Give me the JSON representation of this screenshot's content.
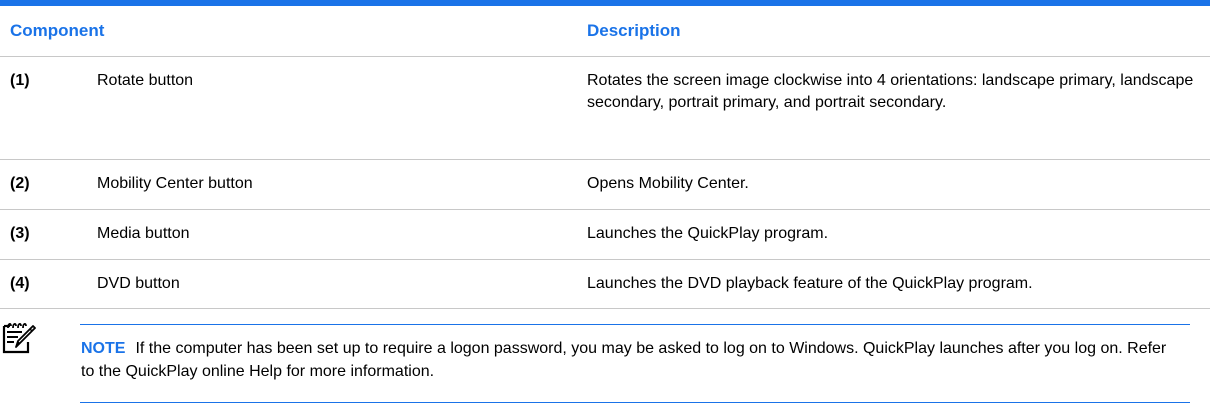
{
  "table": {
    "headers": {
      "component": "Component",
      "description": "Description"
    },
    "rows": [
      {
        "number": "(1)",
        "name": "Rotate button",
        "description": "Rotates the screen image clockwise into 4 orientations: landscape primary, landscape secondary, portrait primary, and portrait secondary."
      },
      {
        "number": "(2)",
        "name": "Mobility Center button",
        "description": "Opens Mobility Center."
      },
      {
        "number": "(3)",
        "name": "Media button",
        "description": "Launches the QuickPlay program."
      },
      {
        "number": "(4)",
        "name": "DVD button",
        "description": "Launches the DVD playback feature of the QuickPlay program."
      }
    ]
  },
  "note": {
    "icon": "note-pencil-icon",
    "label": "NOTE",
    "text": "If the computer has been set up to require a logon password, you may be asked to log on to Windows. QuickPlay launches after you log on. Refer to the QuickPlay online Help for more information."
  },
  "colors": {
    "accent": "#1a73e8",
    "rule": "#c8c8c8",
    "text": "#000000"
  }
}
